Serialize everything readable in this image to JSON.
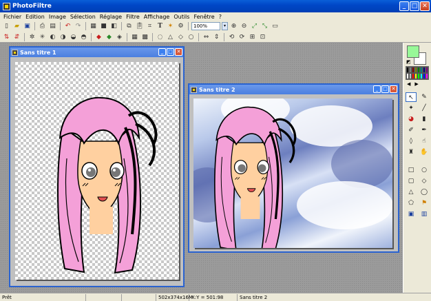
{
  "app": {
    "title": "PhotoFiltre"
  },
  "menu": [
    "Fichier",
    "Edition",
    "Image",
    "Sélection",
    "Réglage",
    "Filtre",
    "Affichage",
    "Outils",
    "Fenêtre",
    "?"
  ],
  "toolbar": {
    "zoom_value": "100%",
    "text_tool_label": "T"
  },
  "windows": [
    {
      "title": "Sans titre 1"
    },
    {
      "title": "Sans titre 2"
    }
  ],
  "colors": {
    "foreground": "#98f898",
    "background": "#ffffff",
    "hair": "#f4a0d8",
    "skin": "#ffd0a0"
  },
  "statusbar": {
    "ready": "Prêt",
    "dimensions": "502x374x16M",
    "coords": "X:Y = 501:98",
    "doc": "Sans titre 2"
  },
  "icons": {
    "toolbar1": [
      "new-icon",
      "open-icon",
      "save-icon",
      "print-icon",
      "scan-icon",
      "undo-icon",
      "redo-icon",
      "image-icon",
      "color-icon",
      "grayscale-icon",
      "copy-icon",
      "paste-icon",
      "crop-icon",
      "text-icon",
      "filter-icon",
      "effect-icon",
      "zoom-in-icon",
      "zoom-out-icon",
      "fit-icon",
      "actual-size-icon",
      "fullscreen-icon"
    ],
    "tools": [
      "select-icon",
      "eyedropper-icon",
      "wand-icon",
      "line-icon",
      "bucket-icon",
      "spray-icon",
      "brush-icon",
      "pen-icon",
      "drop-icon",
      "smudge-icon",
      "stamp-icon",
      "hand-icon",
      "rect-icon",
      "ellipse-icon",
      "round-rect-icon",
      "diamond-icon",
      "triangle-icon",
      "lasso-icon",
      "polygon-icon",
      "magic-lasso-icon",
      "selection-mode-icon",
      "mask-icon"
    ]
  }
}
